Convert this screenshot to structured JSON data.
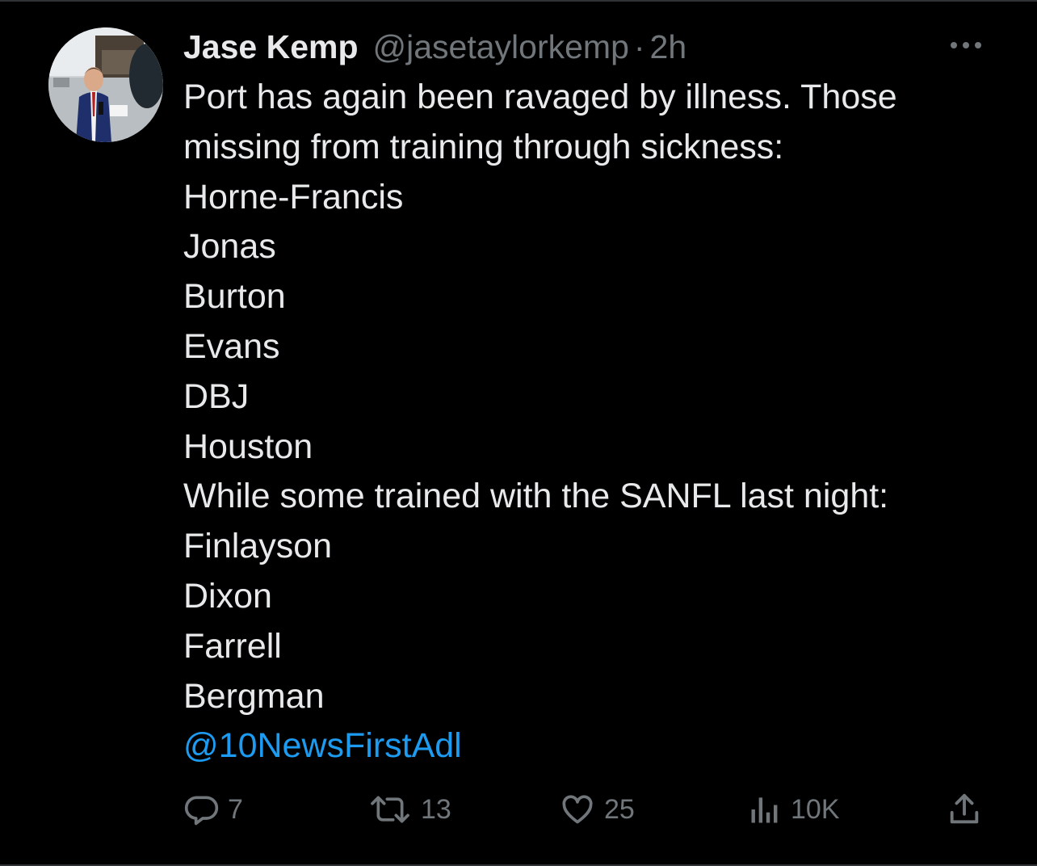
{
  "tweet": {
    "author": {
      "display_name": "Jase Kemp",
      "handle": "@jasetaylorkemp",
      "separator": "·",
      "time": "2h"
    },
    "lines": [
      "Port has again been ravaged by illness. Those",
      "missing from training through sickness:",
      "Horne-Francis",
      "Jonas",
      "Burton",
      "Evans",
      "DBJ",
      "Houston",
      "While some trained with the SANFL last night:",
      "Finlayson",
      "Dixon",
      "Farrell",
      "Bergman"
    ],
    "mention": "@10NewsFirstAdl",
    "actions": {
      "replies": "7",
      "reposts": "13",
      "likes": "25",
      "views": "10K"
    }
  },
  "colors": {
    "background": "#000000",
    "text": "#e7e9ea",
    "muted": "#71767b",
    "link": "#1d9bf0",
    "divider": "#2f3336"
  },
  "icons": [
    "more-icon",
    "reply-icon",
    "repost-icon",
    "like-icon",
    "views-icon",
    "share-icon"
  ]
}
